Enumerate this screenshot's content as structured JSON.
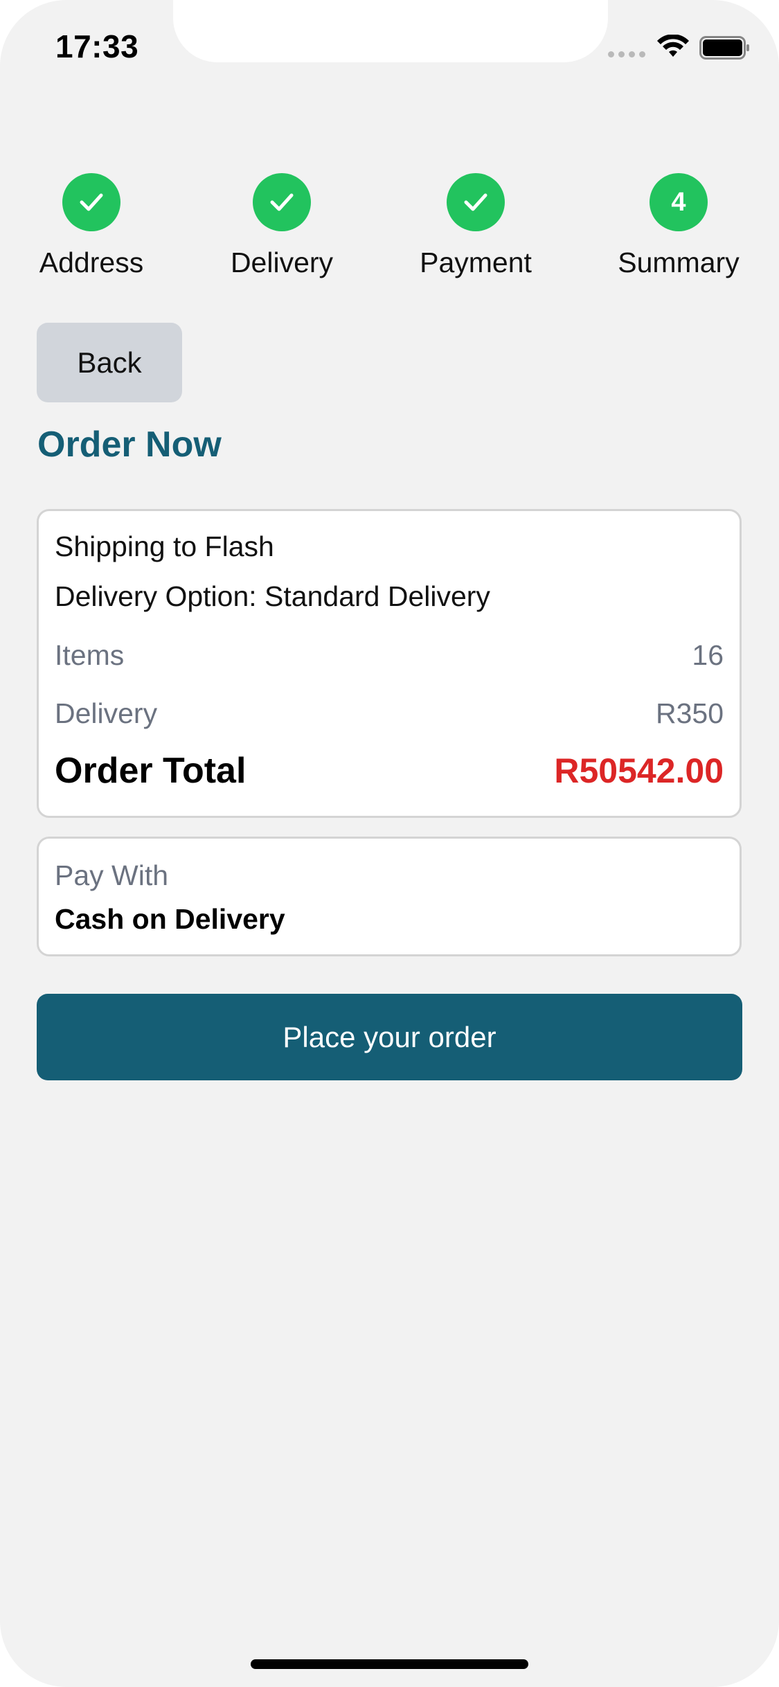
{
  "status_bar": {
    "time": "17:33"
  },
  "steps": [
    {
      "label": "Address",
      "state": "complete",
      "icon": "check-icon"
    },
    {
      "label": "Delivery",
      "state": "complete",
      "icon": "check-icon"
    },
    {
      "label": "Payment",
      "state": "complete",
      "icon": "check-icon"
    },
    {
      "label": "Summary",
      "state": "current",
      "number": "4"
    }
  ],
  "back_label": "Back",
  "heading": "Order Now",
  "summary": {
    "shipping": "Shipping to Flash",
    "delivery_option": "Delivery Option: Standard Delivery",
    "items_label": "Items",
    "items_value": "16",
    "delivery_label": "Delivery",
    "delivery_value": "R350",
    "total_label": "Order Total",
    "total_value": "R50542.00"
  },
  "payment": {
    "label": "Pay With",
    "method": "Cash on Delivery"
  },
  "place_order_label": "Place your order",
  "colors": {
    "accent": "#155e75",
    "success": "#22c35e",
    "total": "#dc2626",
    "background": "#f2f2f2"
  }
}
